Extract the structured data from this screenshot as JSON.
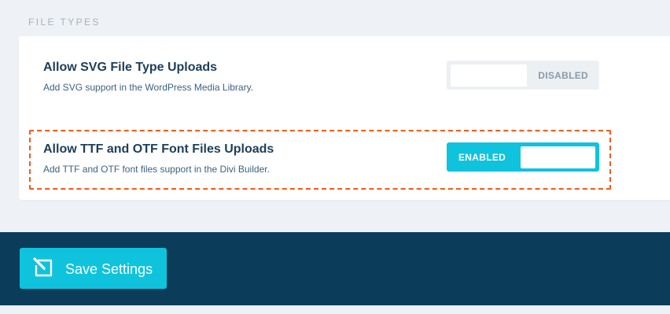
{
  "section": {
    "label": "FILE TYPES"
  },
  "settings": [
    {
      "title": "Allow SVG File Type Uploads",
      "description": "Add SVG support in the WordPress Media Library.",
      "toggle_label": "DISABLED",
      "enabled": false
    },
    {
      "title": "Allow TTF and OTF Font Files Uploads",
      "description": "Add TTF and OTF font files support in the Divi Builder.",
      "toggle_label": "ENABLED",
      "enabled": true
    }
  ],
  "footer": {
    "save_label": "Save Settings",
    "save_icon": "pencil-edit-icon"
  },
  "colors": {
    "accent": "#0fc3dd",
    "footer_bg": "#0b3d5a",
    "title_text": "#1d3e59",
    "highlight_border": "#f25a1c"
  }
}
